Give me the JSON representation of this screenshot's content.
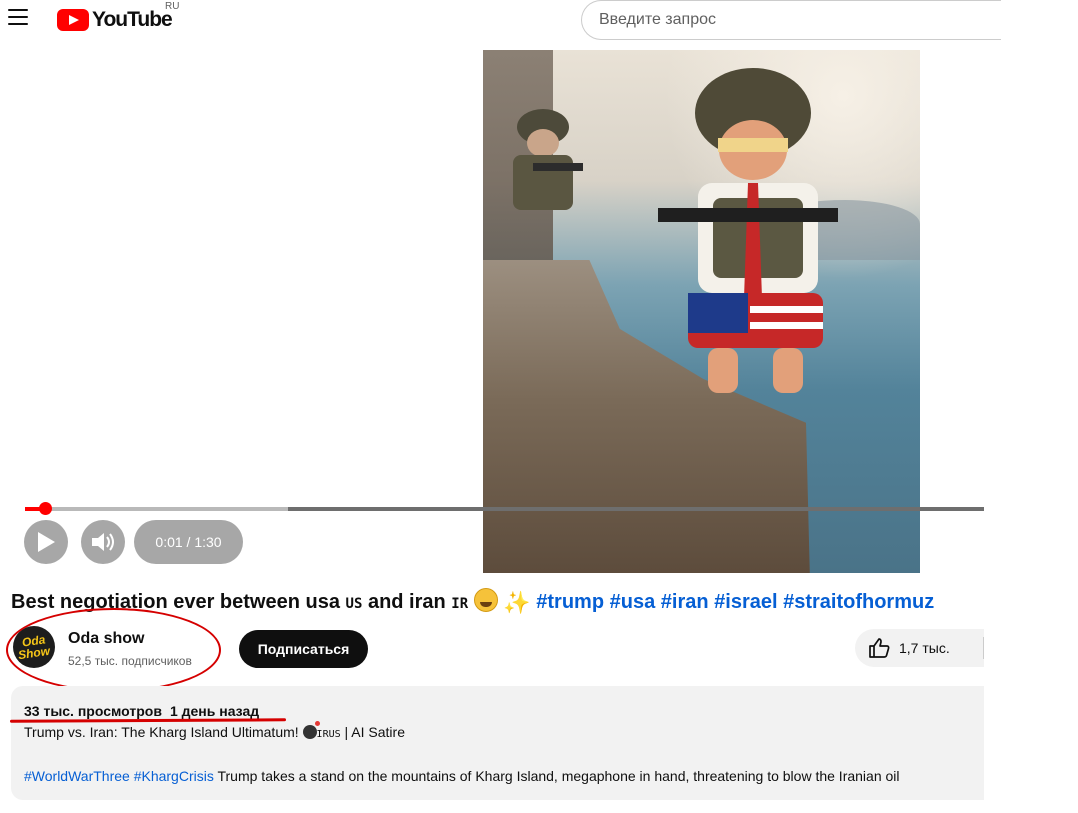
{
  "header": {
    "logo_text": "YouTube",
    "country": "RU",
    "search_placeholder": "Введите запрос"
  },
  "player": {
    "time": "0:01 / 1:30",
    "progress_fraction": 0.011,
    "buffered_fraction": 0.27
  },
  "video": {
    "title_parts": {
      "t1": "Best negotiation ever between usa ",
      "flag1": "US",
      "t2": " and iran ",
      "flag2": "IR",
      "tags": [
        "#trump",
        "#usa",
        "#iran",
        "#israel",
        "#straitofhormuz"
      ]
    }
  },
  "channel": {
    "avatar_text_1": "Oda",
    "avatar_text_2": "Show",
    "name": "Oda show",
    "subscribers": "52,5 тыс. подписчиков",
    "subscribe_label": "Подписаться",
    "likes": "1,7 тыс."
  },
  "description": {
    "views": "33 тыс. просмотров",
    "date": "1 день назад",
    "line1_a": "Trump vs. Iran: The Kharg Island Ultimatum! ",
    "line1_flag": "IRUS",
    "line1_b": " | AI Satire",
    "line2_tags": [
      "#WorldWarThree",
      "#KhargCrisis"
    ],
    "line2_text": " Trump takes a stand on the mountains of Kharg Island, megaphone in hand, threatening to blow the Iranian oil"
  },
  "colors": {
    "accent": "#ff0000",
    "link": "#065fd4",
    "annotation": "#d50000"
  }
}
